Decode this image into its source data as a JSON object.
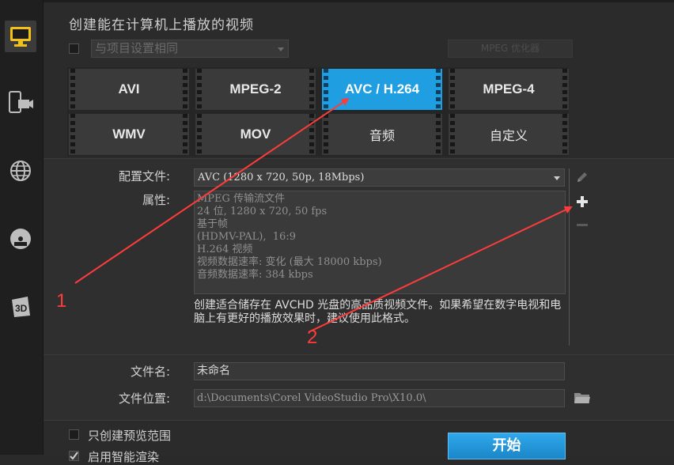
{
  "title": "创建能在计算机上播放的视频",
  "same_as_project": {
    "label": "与项目设置相同",
    "checked": false
  },
  "mpeg_optimizer": "MPEG 优化器",
  "formats": [
    {
      "label": "AVI",
      "selected": false
    },
    {
      "label": "MPEG-2",
      "selected": false
    },
    {
      "label": "AVC / H.264",
      "selected": true
    },
    {
      "label": "MPEG-4",
      "selected": false
    },
    {
      "label": "WMV",
      "selected": false
    },
    {
      "label": "MOV",
      "selected": false
    },
    {
      "label": "音频",
      "selected": false
    },
    {
      "label": "自定义",
      "selected": false
    }
  ],
  "profile": {
    "label": "配置文件:",
    "value": "AVC (1280 x 720, 50p, 18Mbps)"
  },
  "properties": {
    "label": "属性:",
    "lines": [
      "MPEG 传输流文件",
      "24 位, 1280 x 720, 50 fps",
      "基于帧",
      "(HDMV-PAL),  16:9",
      "H.264 视频",
      "视频数据速率: 变化 (最大 18000 kbps)",
      "音频数据速率: 384 kbps"
    ]
  },
  "description": "创建适合储存在 AVCHD 光盘的高品质视频文件。如果希望在数字电视和电脑上有更好的播放效果时，建议使用此格式。",
  "file_name": {
    "label": "文件名:",
    "value": "未命名"
  },
  "file_location": {
    "label": "文件位置:",
    "value": "d:\\Documents\\Corel VideoStudio Pro\\X10.0\\"
  },
  "preview_range": {
    "label": "只创建预览范围",
    "checked": false
  },
  "smart_render": {
    "label": "启用智能渲染",
    "checked": true
  },
  "start_button": "开始",
  "sidebar": [
    "computer-icon",
    "device-icon",
    "web-icon",
    "disc-icon",
    "3d-icon"
  ],
  "annotations": {
    "one": "1",
    "two": "2",
    "color": "#ff3b3b"
  }
}
